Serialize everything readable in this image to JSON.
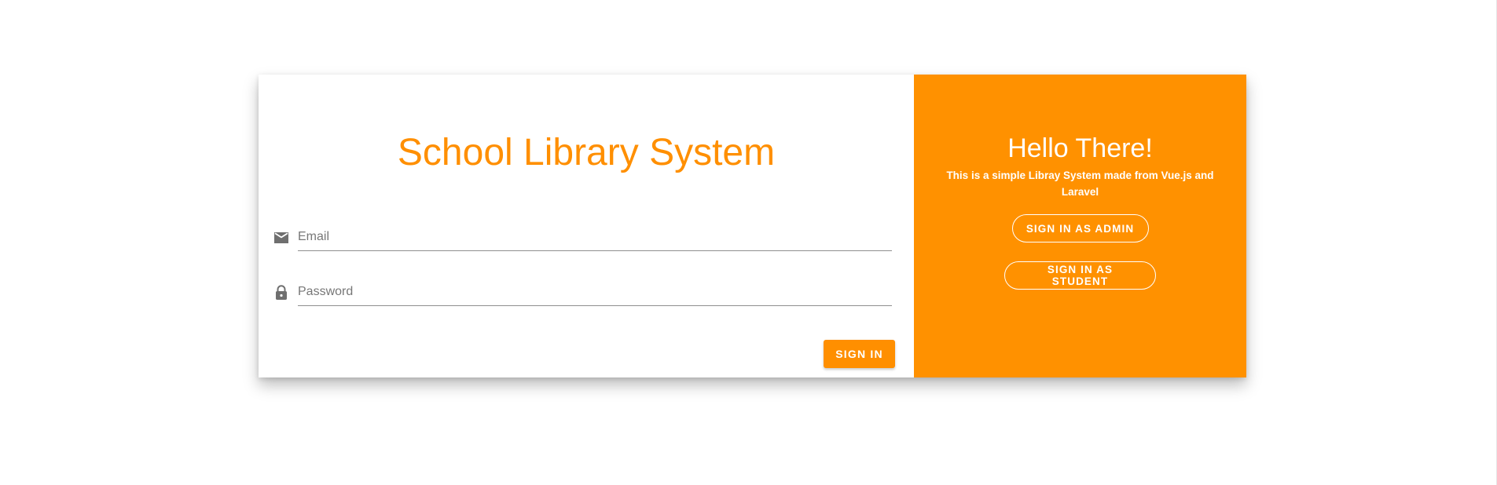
{
  "login": {
    "title": "School Library System",
    "email": {
      "placeholder": "Email",
      "value": "",
      "icon": "email-icon"
    },
    "password": {
      "placeholder": "Password",
      "value": "",
      "icon": "lock-icon"
    },
    "submit_label": "SIGN IN"
  },
  "welcome": {
    "title": "Hello There!",
    "description": "This is a simple Libray System made from Vue.js and Laravel",
    "admin_button_label": "SIGN IN AS ADMIN",
    "student_button_label": "SIGN IN AS STUDENT"
  },
  "colors": {
    "accent": "#ff8f00",
    "panel": "#ff9100",
    "text_white": "#ffffff",
    "icon_gray": "#6f6f6f"
  }
}
